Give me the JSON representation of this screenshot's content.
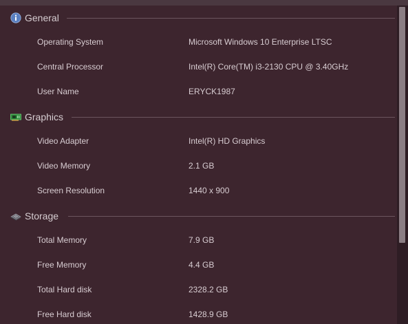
{
  "sections": [
    {
      "title": "General",
      "icon": "info-icon",
      "rows": [
        {
          "label": "Operating System",
          "value": "Microsoft Windows 10 Enterprise LTSC"
        },
        {
          "label": "Central Processor",
          "value": "Intel(R) Core(TM) i3-2130 CPU @ 3.40GHz"
        },
        {
          "label": "User Name",
          "value": "ERYCK1987"
        }
      ]
    },
    {
      "title": "Graphics",
      "icon": "graphics-card-icon",
      "rows": [
        {
          "label": "Video Adapter",
          "value": "Intel(R) HD Graphics"
        },
        {
          "label": "Video Memory",
          "value": "2.1 GB"
        },
        {
          "label": "Screen Resolution",
          "value": "1440 x 900"
        }
      ]
    },
    {
      "title": "Storage",
      "icon": "storage-icon",
      "rows": [
        {
          "label": "Total Memory",
          "value": "7.9 GB"
        },
        {
          "label": "Free Memory",
          "value": "4.4 GB"
        },
        {
          "label": "Total Hard disk",
          "value": "2328.2 GB"
        },
        {
          "label": "Free Hard disk",
          "value": "1428.9 GB"
        }
      ]
    }
  ],
  "colors": {
    "background": "#3d252e",
    "text": "#d8cdd2",
    "rule": "#6c565f",
    "scrollbar_thumb": "#8b7e84",
    "info_icon": "#5a7fc0",
    "graphics_icon": "#3fae4e"
  }
}
